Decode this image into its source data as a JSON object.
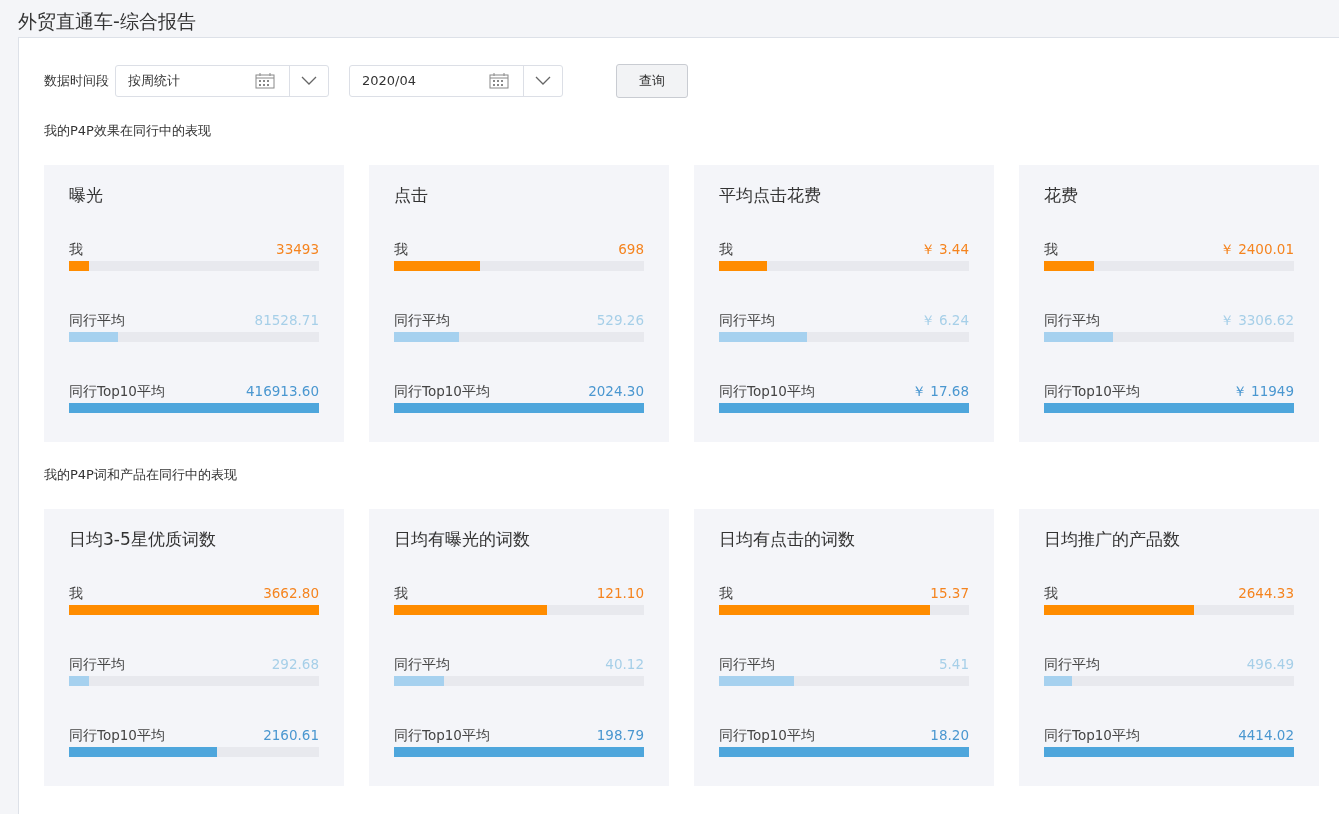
{
  "page_title": "外贸直通车-综合报告",
  "filter": {
    "label": "数据时间段",
    "period": {
      "value": "按周统计"
    },
    "date": {
      "value": "2020/04"
    },
    "query_button": "查询"
  },
  "sections": [
    {
      "title": "我的P4P效果在同行中的表现",
      "cards": [
        {
          "title": "曝光",
          "metrics": [
            {
              "kind": "me",
              "label": "我",
              "value": "33493",
              "level": 0.08
            },
            {
              "kind": "avg",
              "label": "同行平均",
              "value": "81528.71",
              "level": 0.196
            },
            {
              "kind": "top",
              "label": "同行Top10平均",
              "value": "416913.60",
              "level": 1
            }
          ]
        },
        {
          "title": "点击",
          "metrics": [
            {
              "kind": "me",
              "label": "我",
              "value": "698",
              "level": 0.344
            },
            {
              "kind": "avg",
              "label": "同行平均",
              "value": "529.26",
              "level": 0.26
            },
            {
              "kind": "top",
              "label": "同行Top10平均",
              "value": "2024.30",
              "level": 1
            }
          ]
        },
        {
          "title": "平均点击花费",
          "metrics": [
            {
              "kind": "me",
              "label": "我",
              "value": "￥ 3.44",
              "level": 0.19
            },
            {
              "kind": "avg",
              "label": "同行平均",
              "value": "￥ 6.24",
              "level": 0.35
            },
            {
              "kind": "top",
              "label": "同行Top10平均",
              "value": "￥ 17.68",
              "level": 1
            }
          ]
        },
        {
          "title": "花费",
          "metrics": [
            {
              "kind": "me",
              "label": "我",
              "value": "￥ 2400.01",
              "level": 0.2
            },
            {
              "kind": "avg",
              "label": "同行平均",
              "value": "￥ 3306.62",
              "level": 0.276
            },
            {
              "kind": "top",
              "label": "同行Top10平均",
              "value": "￥ 11949",
              "level": 1
            }
          ]
        }
      ]
    },
    {
      "title": "我的P4P词和产品在同行中的表现",
      "cards": [
        {
          "title": "日均3-5星优质词数",
          "metrics": [
            {
              "kind": "me",
              "label": "我",
              "value": "3662.80",
              "level": 1
            },
            {
              "kind": "avg",
              "label": "同行平均",
              "value": "292.68",
              "level": 0.08
            },
            {
              "kind": "top",
              "label": "同行Top10平均",
              "value": "2160.61",
              "level": 0.59
            }
          ]
        },
        {
          "title": "日均有曝光的词数",
          "metrics": [
            {
              "kind": "me",
              "label": "我",
              "value": "121.10",
              "level": 0.61
            },
            {
              "kind": "avg",
              "label": "同行平均",
              "value": "40.12",
              "level": 0.2
            },
            {
              "kind": "top",
              "label": "同行Top10平均",
              "value": "198.79",
              "level": 1
            }
          ]
        },
        {
          "title": "日均有点击的词数",
          "metrics": [
            {
              "kind": "me",
              "label": "我",
              "value": "15.37",
              "level": 0.845
            },
            {
              "kind": "avg",
              "label": "同行平均",
              "value": "5.41",
              "level": 0.3
            },
            {
              "kind": "top",
              "label": "同行Top10平均",
              "value": "18.20",
              "level": 1
            }
          ]
        },
        {
          "title": "日均推广的产品数",
          "metrics": [
            {
              "kind": "me",
              "label": "我",
              "value": "2644.33",
              "level": 0.6
            },
            {
              "kind": "avg",
              "label": "同行平均",
              "value": "496.49",
              "level": 0.11
            },
            {
              "kind": "top",
              "label": "同行Top10平均",
              "value": "4414.02",
              "level": 1
            }
          ]
        }
      ]
    }
  ]
}
